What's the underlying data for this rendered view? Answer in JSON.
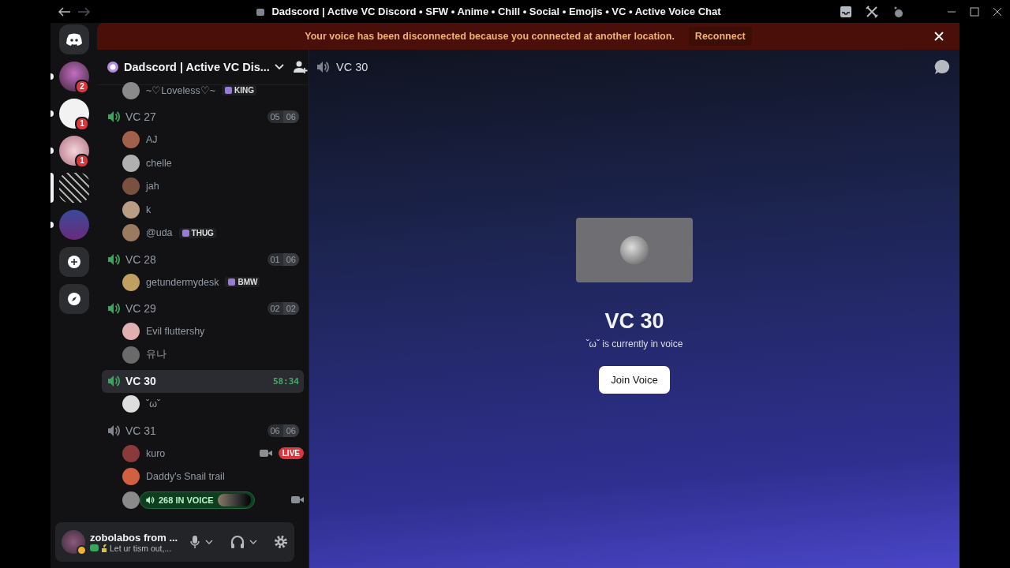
{
  "window": {
    "title": "Dadscord | Active VC Discord • SFW • Anime • Chill • Social • Emojis • VC • Active Voice Chat"
  },
  "banner": {
    "message": "Your voice has been disconnected because you connected at another location.",
    "action": "Reconnect"
  },
  "servers": [
    {
      "selected": false,
      "badge": "2"
    },
    {
      "selected": false,
      "badge": "1"
    },
    {
      "selected": false,
      "badge": "1"
    },
    {
      "selected": true
    },
    {
      "selected": false
    }
  ],
  "server": {
    "name": "Dadscord | Active VC Dis..."
  },
  "channel_header": {
    "name": "VC 30"
  },
  "overflow_members": [
    {
      "name": "~♡Loveless♡~",
      "badge": "KING"
    }
  ],
  "channels": [
    {
      "name": "VC 27",
      "active": true,
      "selected": false,
      "count": "05",
      "limit": "06",
      "members": [
        {
          "name": "AJ"
        },
        {
          "name": "chelle"
        },
        {
          "name": "jah"
        },
        {
          "name": "k"
        },
        {
          "name": "@uda",
          "badge": "THUG"
        }
      ]
    },
    {
      "name": "VC 28",
      "active": true,
      "selected": false,
      "count": "01",
      "limit": "06",
      "members": [
        {
          "name": "getundermydesk",
          "badge": "BMW"
        }
      ]
    },
    {
      "name": "VC 29",
      "active": true,
      "selected": false,
      "count": "02",
      "limit": "02",
      "members": [
        {
          "name": "Evil fluttershy"
        },
        {
          "name": "유나"
        }
      ]
    },
    {
      "name": "VC 30",
      "active": true,
      "selected": true,
      "timer": "58:34",
      "members": [
        {
          "name": "ˇωˇ"
        }
      ]
    },
    {
      "name": "VC 31",
      "active": false,
      "selected": false,
      "count": "06",
      "limit": "06",
      "members": [
        {
          "name": "kuro",
          "camera": true,
          "live": "LIVE"
        },
        {
          "name": "Daddy's Snail trail"
        },
        {
          "camera": true,
          "voice_pill": "268 IN VOICE"
        }
      ]
    }
  ],
  "main": {
    "title": "VC 30",
    "subtitle": "ˇωˇ is currently in voice",
    "button": "Join Voice"
  },
  "user": {
    "name": "zobolabos from ...",
    "status": "Let ur tism out,..."
  }
}
